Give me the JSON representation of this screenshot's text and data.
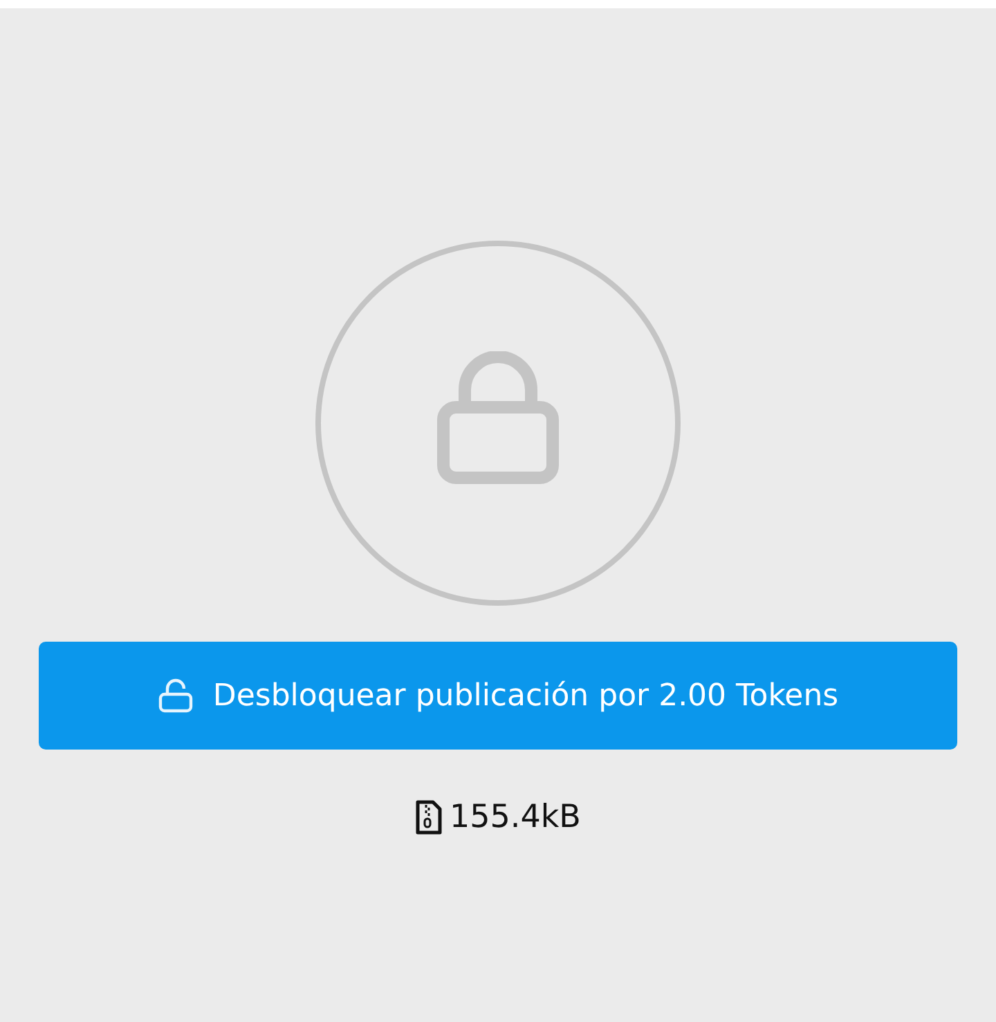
{
  "unlock_button": {
    "label": "Desbloquear publicación por 2.00 Tokens"
  },
  "file": {
    "size": "155.4kB"
  }
}
